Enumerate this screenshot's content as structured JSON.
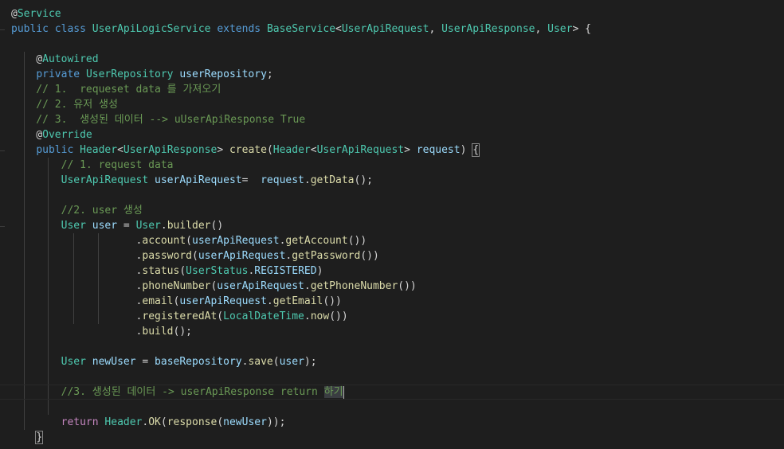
{
  "editor": {
    "language": "java",
    "theme_colors": {
      "background": "#1e1e1e",
      "keyword": "#569cd6",
      "type": "#4ec9b0",
      "function": "#dcdcaa",
      "variable": "#9cdcfe",
      "comment": "#6a9955",
      "plain": "#d4d4d4"
    },
    "lines": [
      [
        {
          "t": "@",
          "c": "pl"
        },
        {
          "t": "Service",
          "c": "an"
        }
      ],
      [
        {
          "t": "public",
          "c": "kw"
        },
        {
          "t": " ",
          "c": "pl"
        },
        {
          "t": "class",
          "c": "kw"
        },
        {
          "t": " ",
          "c": "pl"
        },
        {
          "t": "UserApiLogicService",
          "c": "ty"
        },
        {
          "t": " ",
          "c": "pl"
        },
        {
          "t": "extends",
          "c": "kw"
        },
        {
          "t": " ",
          "c": "pl"
        },
        {
          "t": "BaseService",
          "c": "ty"
        },
        {
          "t": "<",
          "c": "pl"
        },
        {
          "t": "UserApiRequest",
          "c": "ty"
        },
        {
          "t": ", ",
          "c": "pl"
        },
        {
          "t": "UserApiResponse",
          "c": "ty"
        },
        {
          "t": ", ",
          "c": "pl"
        },
        {
          "t": "User",
          "c": "ty"
        },
        {
          "t": "> {",
          "c": "pl"
        }
      ],
      [],
      [
        {
          "t": "    @",
          "c": "pl"
        },
        {
          "t": "Autowired",
          "c": "an"
        }
      ],
      [
        {
          "t": "    ",
          "c": "pl"
        },
        {
          "t": "private",
          "c": "kw"
        },
        {
          "t": " ",
          "c": "pl"
        },
        {
          "t": "UserRepository",
          "c": "ty"
        },
        {
          "t": " ",
          "c": "pl"
        },
        {
          "t": "userRepository",
          "c": "var"
        },
        {
          "t": ";",
          "c": "pl"
        }
      ],
      [
        {
          "t": "    // 1.  requeset data 를 가져오기",
          "c": "cm"
        }
      ],
      [
        {
          "t": "    // 2. 유저 생성",
          "c": "cm"
        }
      ],
      [
        {
          "t": "    // 3.  생성된 데이터 --> uUserApiResponse True",
          "c": "cm"
        }
      ],
      [
        {
          "t": "    @",
          "c": "pl"
        },
        {
          "t": "Override",
          "c": "an"
        }
      ],
      [
        {
          "t": "    ",
          "c": "pl"
        },
        {
          "t": "public",
          "c": "kw"
        },
        {
          "t": " ",
          "c": "pl"
        },
        {
          "t": "Header",
          "c": "ty"
        },
        {
          "t": "<",
          "c": "pl"
        },
        {
          "t": "UserApiResponse",
          "c": "ty"
        },
        {
          "t": "> ",
          "c": "pl"
        },
        {
          "t": "create",
          "c": "fn"
        },
        {
          "t": "(",
          "c": "pl"
        },
        {
          "t": "Header",
          "c": "ty"
        },
        {
          "t": "<",
          "c": "pl"
        },
        {
          "t": "UserApiRequest",
          "c": "ty"
        },
        {
          "t": "> ",
          "c": "pl"
        },
        {
          "t": "request",
          "c": "var"
        },
        {
          "t": ") ",
          "c": "pl"
        },
        {
          "t": "{",
          "c": "pl",
          "m": "bracket"
        }
      ],
      [
        {
          "t": "        // 1. request data",
          "c": "cm"
        }
      ],
      [
        {
          "t": "        ",
          "c": "pl"
        },
        {
          "t": "UserApiRequest",
          "c": "ty"
        },
        {
          "t": " ",
          "c": "pl"
        },
        {
          "t": "userApiRequest",
          "c": "var"
        },
        {
          "t": "=  ",
          "c": "pl"
        },
        {
          "t": "request",
          "c": "var"
        },
        {
          "t": ".",
          "c": "pl"
        },
        {
          "t": "getData",
          "c": "fn"
        },
        {
          "t": "();",
          "c": "pl"
        }
      ],
      [],
      [
        {
          "t": "        //2. user 생성",
          "c": "cm"
        }
      ],
      [
        {
          "t": "        ",
          "c": "pl"
        },
        {
          "t": "User",
          "c": "ty"
        },
        {
          "t": " ",
          "c": "pl"
        },
        {
          "t": "user",
          "c": "var"
        },
        {
          "t": " = ",
          "c": "pl"
        },
        {
          "t": "User",
          "c": "ty"
        },
        {
          "t": ".",
          "c": "pl"
        },
        {
          "t": "builder",
          "c": "fn"
        },
        {
          "t": "()",
          "c": "pl"
        }
      ],
      [
        {
          "t": "                    .",
          "c": "pl"
        },
        {
          "t": "account",
          "c": "fn"
        },
        {
          "t": "(",
          "c": "pl"
        },
        {
          "t": "userApiRequest",
          "c": "var"
        },
        {
          "t": ".",
          "c": "pl"
        },
        {
          "t": "getAccount",
          "c": "fn"
        },
        {
          "t": "())",
          "c": "pl"
        }
      ],
      [
        {
          "t": "                    .",
          "c": "pl"
        },
        {
          "t": "password",
          "c": "fn"
        },
        {
          "t": "(",
          "c": "pl"
        },
        {
          "t": "userApiRequest",
          "c": "var"
        },
        {
          "t": ".",
          "c": "pl"
        },
        {
          "t": "getPassword",
          "c": "fn"
        },
        {
          "t": "())",
          "c": "pl"
        }
      ],
      [
        {
          "t": "                    .",
          "c": "pl"
        },
        {
          "t": "status",
          "c": "fn"
        },
        {
          "t": "(",
          "c": "pl"
        },
        {
          "t": "UserStatus",
          "c": "ty"
        },
        {
          "t": ".",
          "c": "pl"
        },
        {
          "t": "REGISTERED",
          "c": "var"
        },
        {
          "t": ")",
          "c": "pl"
        }
      ],
      [
        {
          "t": "                    .",
          "c": "pl"
        },
        {
          "t": "phoneNumber",
          "c": "fn"
        },
        {
          "t": "(",
          "c": "pl"
        },
        {
          "t": "userApiRequest",
          "c": "var"
        },
        {
          "t": ".",
          "c": "pl"
        },
        {
          "t": "getPhoneNumber",
          "c": "fn"
        },
        {
          "t": "())",
          "c": "pl"
        }
      ],
      [
        {
          "t": "                    .",
          "c": "pl"
        },
        {
          "t": "email",
          "c": "fn"
        },
        {
          "t": "(",
          "c": "pl"
        },
        {
          "t": "userApiRequest",
          "c": "var"
        },
        {
          "t": ".",
          "c": "pl"
        },
        {
          "t": "getEmail",
          "c": "fn"
        },
        {
          "t": "())",
          "c": "pl"
        }
      ],
      [
        {
          "t": "                    .",
          "c": "pl"
        },
        {
          "t": "registeredAt",
          "c": "fn"
        },
        {
          "t": "(",
          "c": "pl"
        },
        {
          "t": "LocalDateTime",
          "c": "ty"
        },
        {
          "t": ".",
          "c": "pl"
        },
        {
          "t": "now",
          "c": "fn"
        },
        {
          "t": "())",
          "c": "pl"
        }
      ],
      [
        {
          "t": "                    .",
          "c": "pl"
        },
        {
          "t": "build",
          "c": "fn"
        },
        {
          "t": "();",
          "c": "pl"
        }
      ],
      [],
      [
        {
          "t": "        ",
          "c": "pl"
        },
        {
          "t": "User",
          "c": "ty"
        },
        {
          "t": " ",
          "c": "pl"
        },
        {
          "t": "newUser",
          "c": "var"
        },
        {
          "t": " = ",
          "c": "pl"
        },
        {
          "t": "baseRepository",
          "c": "var"
        },
        {
          "t": ".",
          "c": "pl"
        },
        {
          "t": "save",
          "c": "fn"
        },
        {
          "t": "(",
          "c": "pl"
        },
        {
          "t": "user",
          "c": "var"
        },
        {
          "t": ");",
          "c": "pl"
        }
      ],
      [],
      [
        {
          "t": "        //3. 생성된 데이터 -> userApiResponse return ",
          "c": "cm"
        },
        {
          "t": "하기",
          "c": "cm",
          "m": "hl"
        },
        {
          "t": "",
          "c": "pl",
          "m": "cursor"
        }
      ],
      [],
      [
        {
          "t": "        ",
          "c": "pl"
        },
        {
          "t": "return",
          "c": "kw2"
        },
        {
          "t": " ",
          "c": "pl"
        },
        {
          "t": "Header",
          "c": "ty"
        },
        {
          "t": ".",
          "c": "pl"
        },
        {
          "t": "OK",
          "c": "fn"
        },
        {
          "t": "(",
          "c": "pl"
        },
        {
          "t": "response",
          "c": "fn"
        },
        {
          "t": "(",
          "c": "pl"
        },
        {
          "t": "newUser",
          "c": "var"
        },
        {
          "t": "));",
          "c": "pl"
        }
      ],
      [
        {
          "t": "    ",
          "c": "pl"
        },
        {
          "t": "}",
          "c": "pl",
          "m": "bracket"
        }
      ]
    ]
  }
}
